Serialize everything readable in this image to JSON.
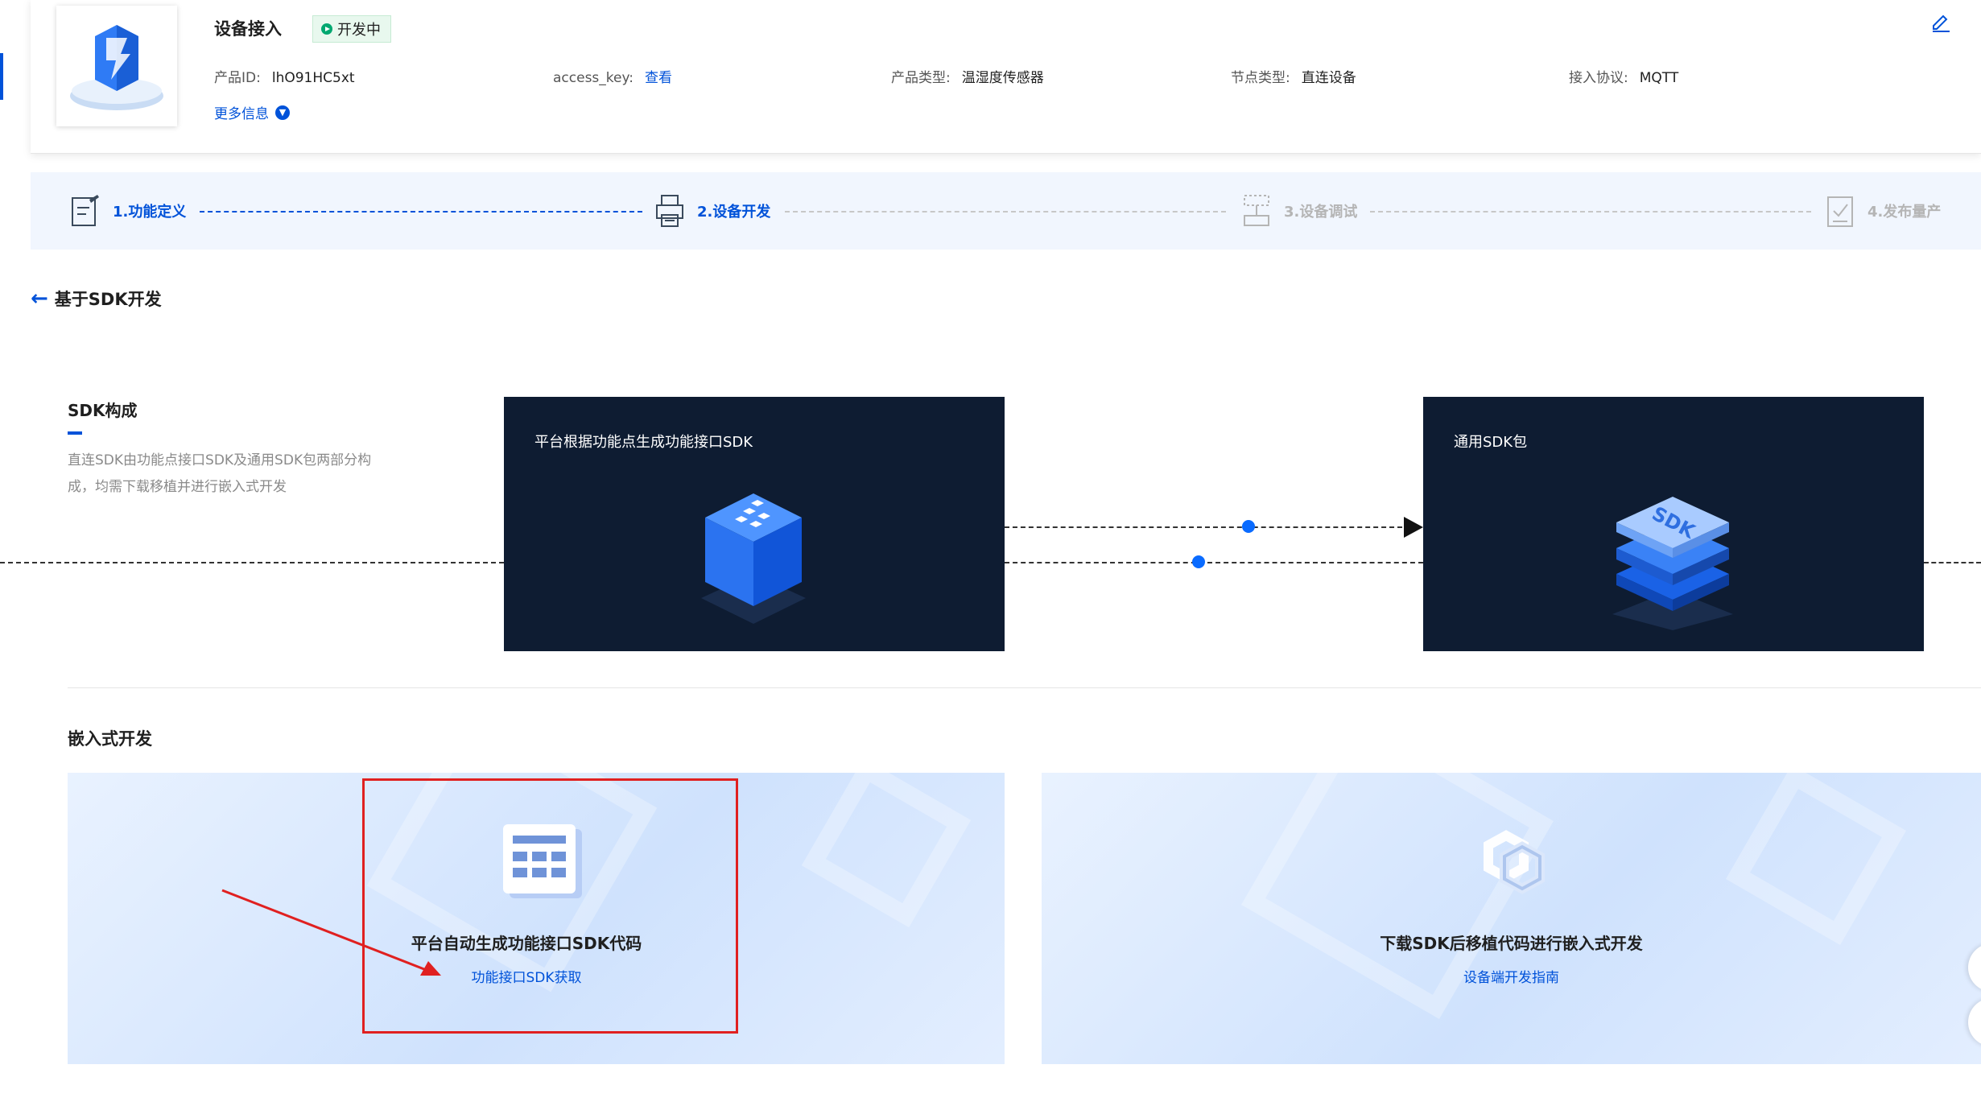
{
  "header": {
    "title": "设备接入",
    "status": "开发中",
    "product_id_label": "产品ID:",
    "product_id": "lhO91HC5xt",
    "access_key_label": "access_key:",
    "access_key_link": "查看",
    "product_type_label": "产品类型:",
    "product_type": "温湿度传感器",
    "node_type_label": "节点类型:",
    "node_type": "直连设备",
    "protocol_label": "接入协议:",
    "protocol": "MQTT",
    "more_info": "更多信息"
  },
  "steps": [
    {
      "label": "1.功能定义",
      "state": "done",
      "icon": "edit-doc-icon"
    },
    {
      "label": "2.设备开发",
      "state": "current",
      "icon": "printer-icon"
    },
    {
      "label": "3.设备调试",
      "state": "todo",
      "icon": "debug-icon"
    },
    {
      "label": "4.发布量产",
      "state": "todo",
      "icon": "checklist-icon"
    }
  ],
  "back": {
    "label": "基于SDK开发"
  },
  "sdk": {
    "title": "SDK构成",
    "description": "直连SDK由功能点接口SDK及通用SDK包两部分构成，均需下载移植并进行嵌入式开发",
    "card1_title": "平台根据功能点生成功能接口SDK",
    "card2_title": "通用SDK包",
    "card2_icon_text": "SDK"
  },
  "embedded": {
    "title": "嵌入式开发",
    "panel1_title": "平台自动生成功能接口SDK代码",
    "panel1_link": "功能接口SDK获取",
    "panel2_title": "下载SDK后移植代码进行嵌入式开发",
    "panel2_link": "设备端开发指南"
  },
  "colors": {
    "primary": "#0052d9",
    "dark_card": "#0e1c32",
    "annotation": "#e02020",
    "status_green": "#00a870"
  }
}
